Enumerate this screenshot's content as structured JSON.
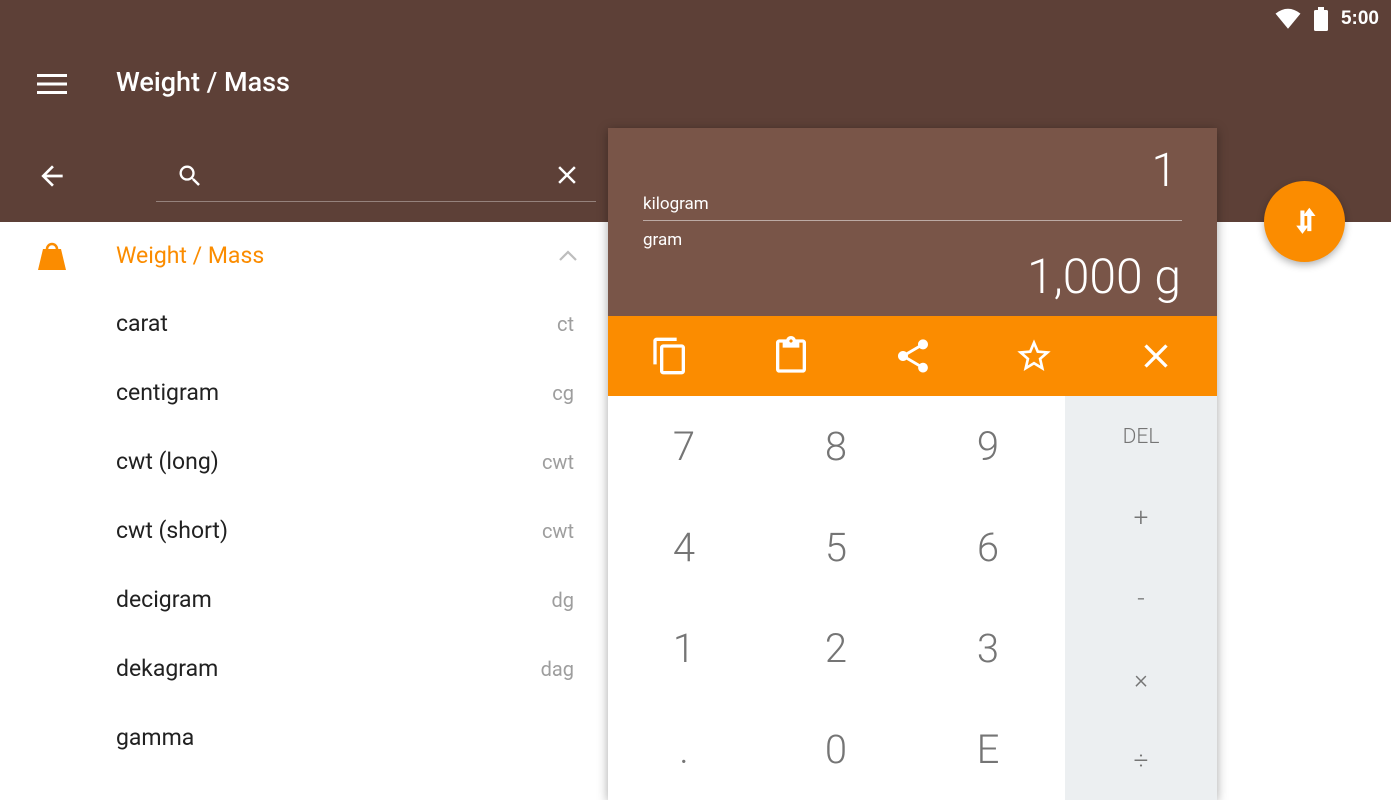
{
  "status_bar": {
    "time": "5:00",
    "icons": [
      "wifi-icon",
      "battery-icon"
    ]
  },
  "toolbar": {
    "title": "Weight / Mass",
    "menu_icon": "hamburger-menu-icon"
  },
  "search": {
    "value": "",
    "placeholder": "",
    "icon": "search-icon",
    "clear_icon": "close-icon",
    "back_icon": "arrow-back-icon"
  },
  "category": {
    "label": "Weight / Mass",
    "icon": "weight-icon",
    "expand_icon": "chevron-up-icon"
  },
  "units": [
    {
      "name": "carat",
      "abbr": "ct"
    },
    {
      "name": "centigram",
      "abbr": "cg"
    },
    {
      "name": "cwt (long)",
      "abbr": "cwt"
    },
    {
      "name": "cwt (short)",
      "abbr": "cwt"
    },
    {
      "name": "decigram",
      "abbr": "dg"
    },
    {
      "name": "dekagram",
      "abbr": "dag"
    },
    {
      "name": "gamma",
      "abbr": ""
    }
  ],
  "converter": {
    "input_value": "1",
    "from_unit": "kilogram",
    "to_unit": "gram",
    "result": "1,000 g",
    "actions": [
      "copy-icon",
      "paste-icon",
      "share-icon",
      "star-icon",
      "close-icon"
    ]
  },
  "keypad": {
    "digits": [
      "7",
      "8",
      "9",
      "4",
      "5",
      "6",
      "1",
      "2",
      "3",
      ".",
      "0",
      "E"
    ],
    "ops": [
      "DEL",
      "+",
      "-",
      "×",
      "÷"
    ]
  },
  "fab": {
    "icon": "swap-units-icon"
  },
  "colors": {
    "primary": "#5D4037",
    "card": "#795548",
    "accent": "#FB8C00",
    "op_pad": "#ECEFF1"
  }
}
